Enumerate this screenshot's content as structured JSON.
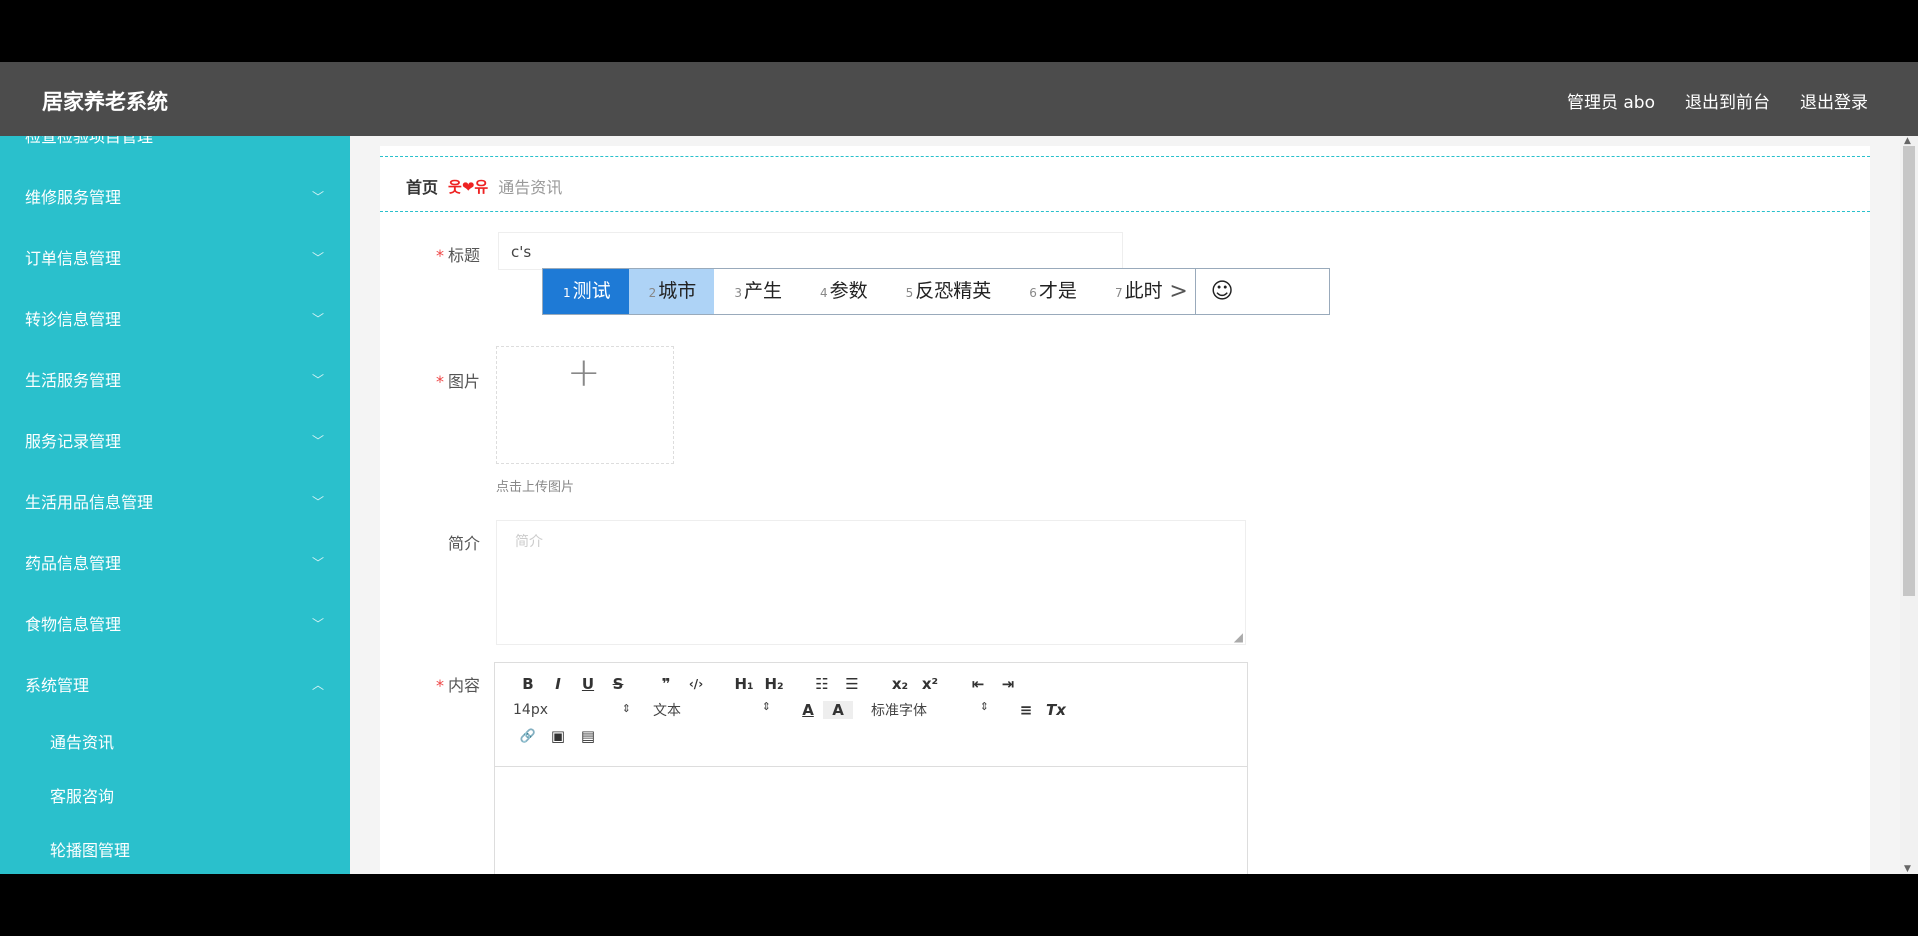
{
  "header": {
    "app_title": "居家养老系统",
    "admin_label": "管理员 abo",
    "back_to_front": "退出到前台",
    "logout": "退出登录"
  },
  "sidebar": {
    "items": [
      {
        "label": "检查检验项目管理",
        "chevron": "﹀"
      },
      {
        "label": "维修服务管理",
        "chevron": "﹀"
      },
      {
        "label": "订单信息管理",
        "chevron": "﹀"
      },
      {
        "label": "转诊信息管理",
        "chevron": "﹀"
      },
      {
        "label": "生活服务管理",
        "chevron": "﹀"
      },
      {
        "label": "服务记录管理",
        "chevron": "﹀"
      },
      {
        "label": "生活用品信息管理",
        "chevron": "﹀"
      },
      {
        "label": "药品信息管理",
        "chevron": "﹀"
      },
      {
        "label": "食物信息管理",
        "chevron": "﹀"
      },
      {
        "label": "系统管理",
        "chevron": "︿"
      }
    ],
    "sub_items": [
      {
        "label": "通告资讯"
      },
      {
        "label": "客服咨询"
      },
      {
        "label": "轮播图管理"
      }
    ]
  },
  "breadcrumb": {
    "home": "首页",
    "separator": "웃❤유",
    "current": "通告资讯"
  },
  "form": {
    "title_label": "标题",
    "title_value": "c's",
    "image_label": "图片",
    "upload_plus": "+",
    "upload_hint": "点击上传图片",
    "intro_label": "简介",
    "intro_placeholder": "简介",
    "content_label": "内容",
    "required_mark": "*"
  },
  "ime": {
    "candidates": [
      {
        "num": "1",
        "text": "测试"
      },
      {
        "num": "2",
        "text": "城市"
      },
      {
        "num": "3",
        "text": "产生"
      },
      {
        "num": "4",
        "text": "参数"
      },
      {
        "num": "5",
        "text": "反恐精英"
      },
      {
        "num": "6",
        "text": "才是"
      },
      {
        "num": "7",
        "text": "此时"
      }
    ],
    "next_arrow": ">",
    "emoji": "☺"
  },
  "editor": {
    "row1": [
      "B",
      "I",
      "U",
      "S",
      "❞",
      "‹/›",
      "H₁",
      "H₂",
      "☷",
      "☰",
      "x₂",
      "x²",
      "⇤",
      "⇥"
    ],
    "font_size": "14px",
    "text_style": "文本",
    "color_a": "A",
    "bg_a": "A",
    "font_family": "标准字体",
    "align": "≡",
    "clear": "Tx",
    "row3": [
      "🔗",
      "▣",
      "▤"
    ],
    "select_arrow": "⇕"
  }
}
